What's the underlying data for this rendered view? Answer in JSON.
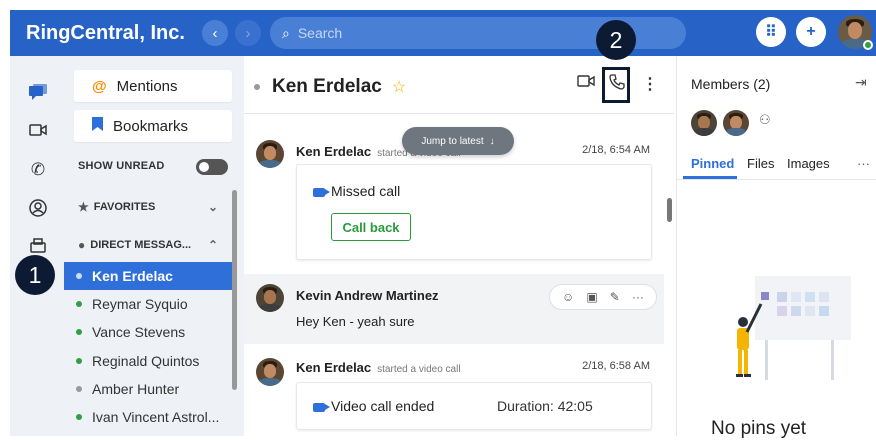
{
  "topbar": {
    "brand": "RingCentral, Inc.",
    "back_icon": "‹",
    "forward_icon": "›",
    "search_placeholder": "Search",
    "dialpad_icon": "⠿",
    "add_icon": "+"
  },
  "sidebar": {
    "mentions": "Mentions",
    "bookmarks": "Bookmarks",
    "show_unread": "SHOW UNREAD",
    "favorites": "FAVORITES",
    "direct_messages": "DIRECT MESSAG...",
    "contacts": [
      {
        "name": "Ken Erdelac",
        "status": "away",
        "active": true
      },
      {
        "name": "Reymar Syquio",
        "status": "online",
        "active": false
      },
      {
        "name": "Vance Stevens",
        "status": "online",
        "active": false
      },
      {
        "name": "Reginald Quintos",
        "status": "online",
        "active": false
      },
      {
        "name": "Amber Hunter",
        "status": "away",
        "active": false
      },
      {
        "name": "Ivan Vincent Astrol...",
        "status": "online",
        "active": false
      }
    ]
  },
  "annotations": {
    "step1": "1",
    "step2": "2"
  },
  "conversation": {
    "title": "Ken Erdelac",
    "jump_label": "Jump to latest",
    "messages": [
      {
        "author": "Ken Erdelac",
        "sub": "started a video call",
        "time": "2/18, 6:54 AM",
        "card_text": "Missed call",
        "card_button": "Call back"
      },
      {
        "author": "Kevin Andrew Martinez",
        "sub": "",
        "time": "",
        "body": "Hey Ken - yeah sure"
      },
      {
        "author": "Ken Erdelac",
        "sub": "started a video call",
        "time": "2/18, 6:58 AM",
        "card_text": "Video call ended",
        "duration": "Duration: 42:05"
      }
    ]
  },
  "right_panel": {
    "members_title": "Members (2)",
    "tabs": [
      "Pinned",
      "Files",
      "Images"
    ],
    "more": "···",
    "empty_text": "No pins yet"
  },
  "colors": {
    "brand_blue": "#2763c7",
    "active_blue": "#2f6fd9",
    "green": "#2b9a3b",
    "annotation": "#0c1b33"
  }
}
